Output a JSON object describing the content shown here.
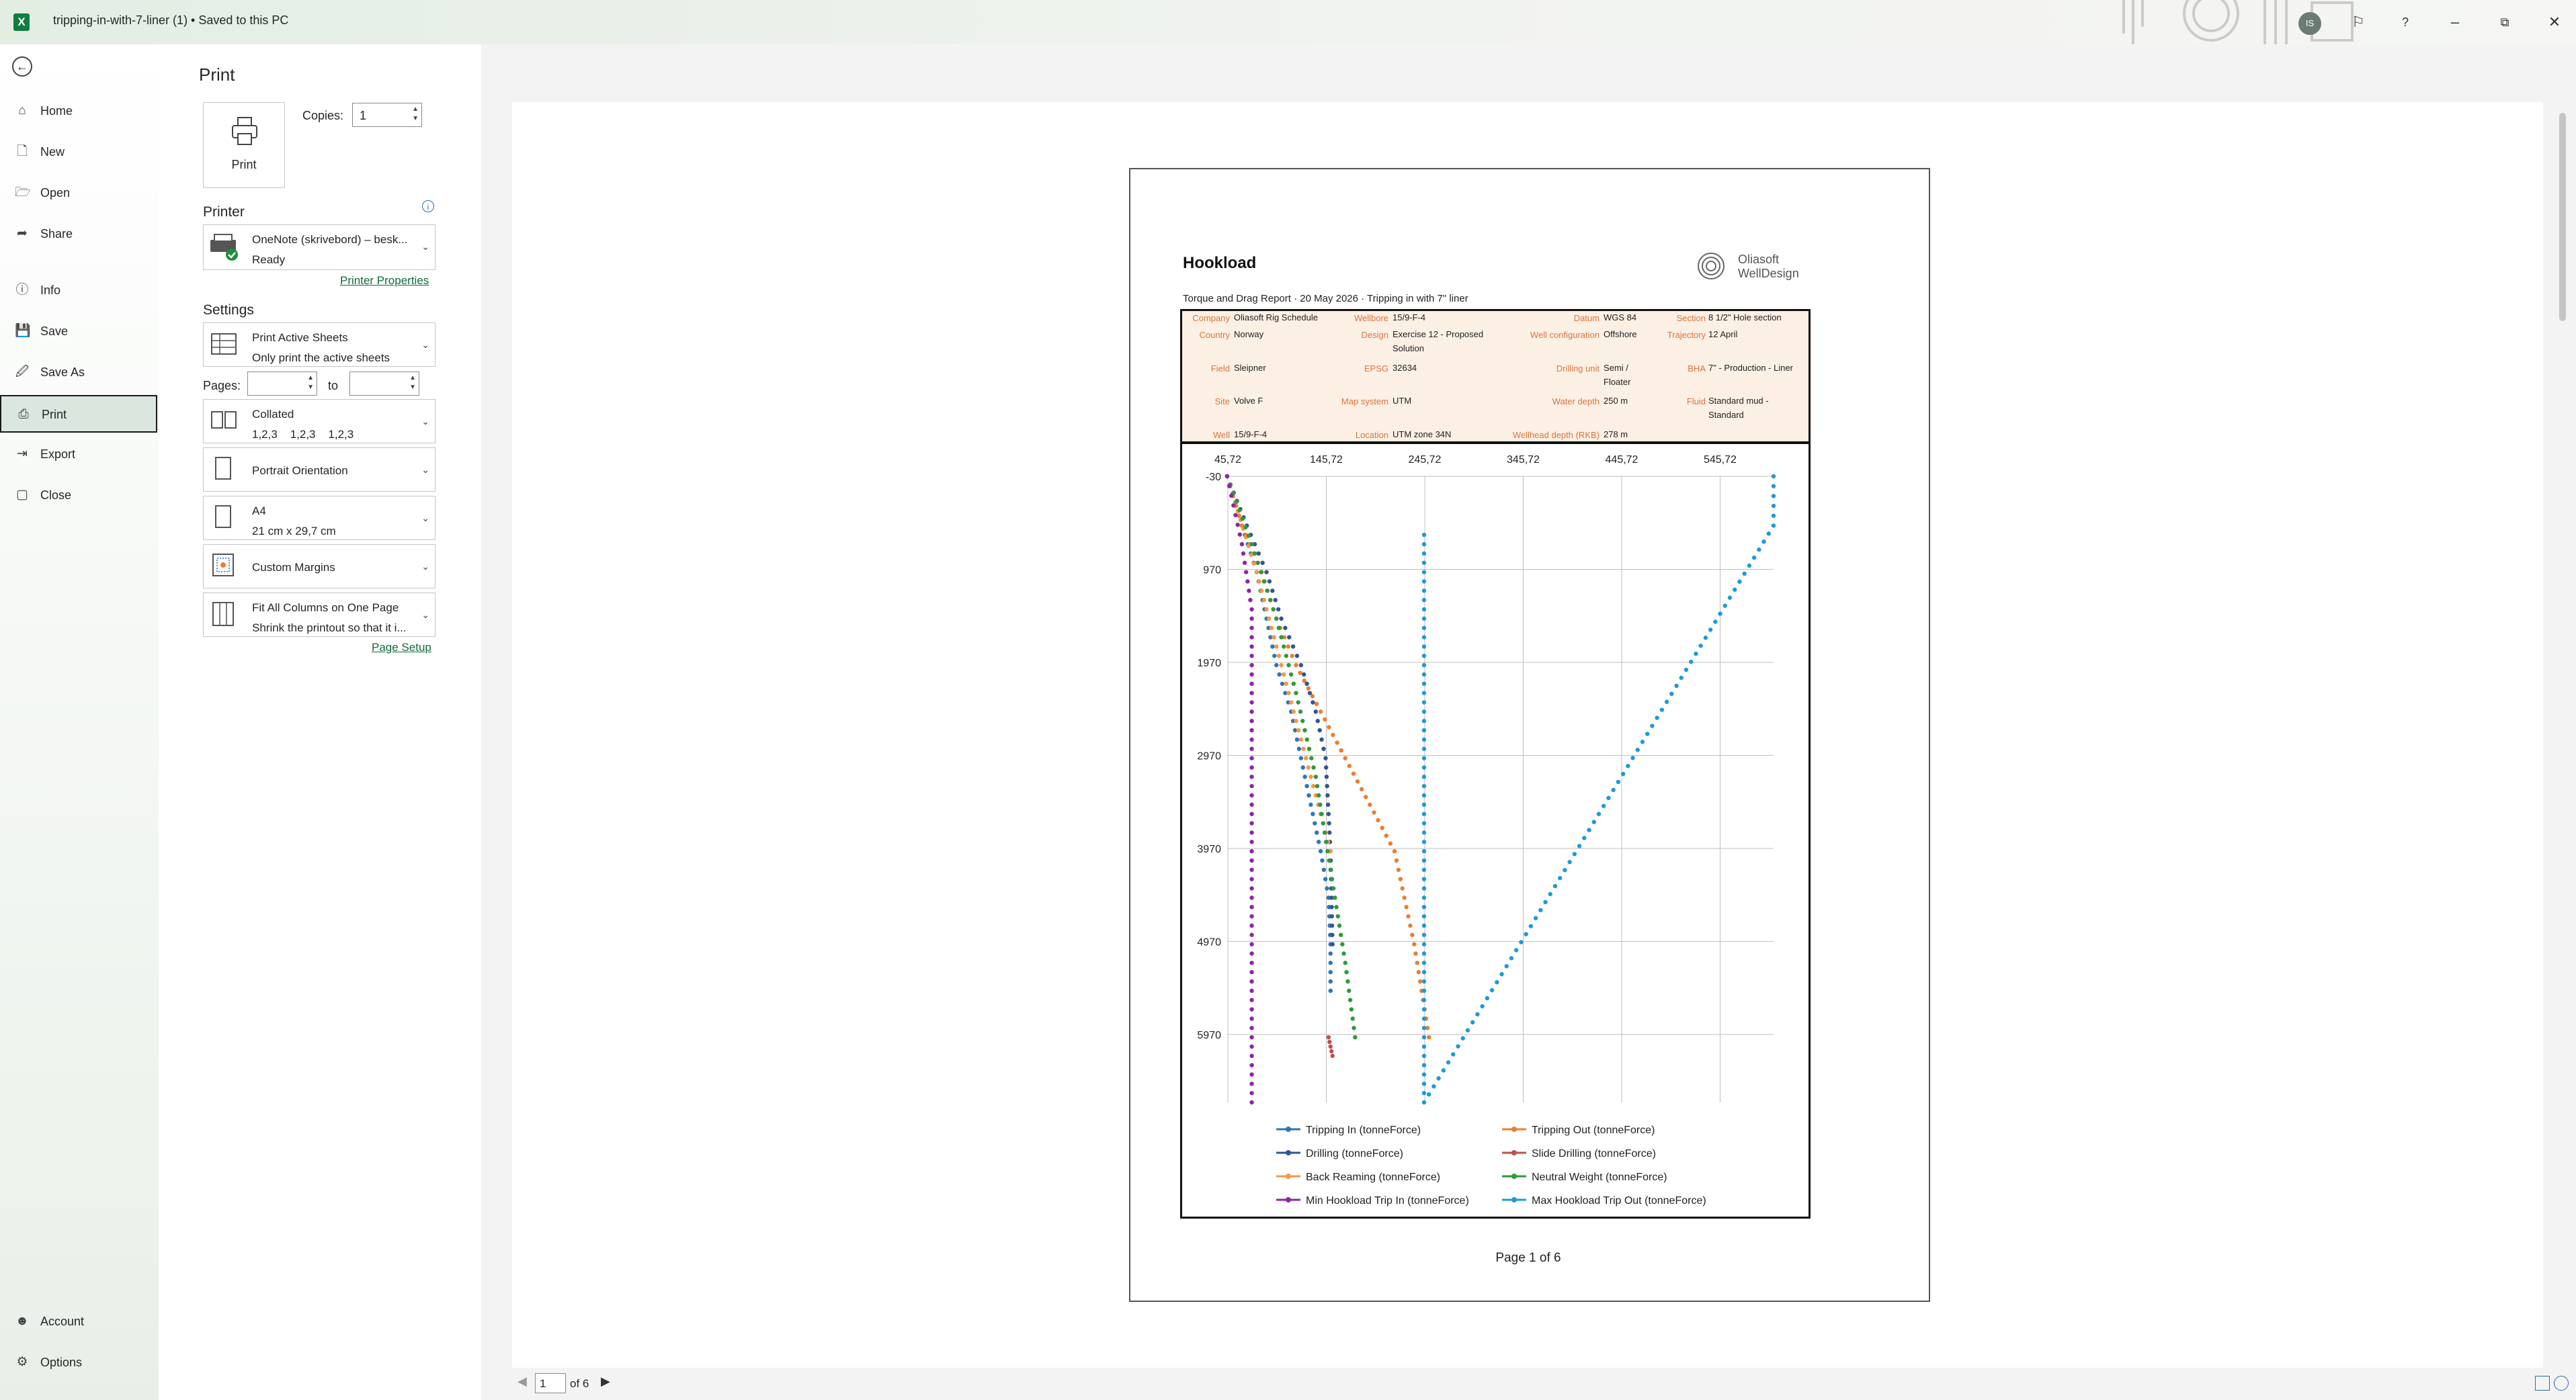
{
  "window": {
    "app_icon": "excel-icon",
    "doc_title": "tripping-in-with-7-liner (1) • Saved to this PC",
    "avatar_initials": "IS",
    "controls": [
      "feedback-icon",
      "help-icon",
      "minimize-icon",
      "restore-icon",
      "close-icon"
    ]
  },
  "nav": {
    "back_icon": "back-arrow-icon",
    "items": [
      {
        "label": "Home",
        "icon": "home-icon"
      },
      {
        "label": "New",
        "icon": "new-doc-icon"
      },
      {
        "label": "Open",
        "icon": "folder-icon"
      },
      {
        "label": "Share",
        "icon": "share-icon"
      },
      {
        "label": "Info",
        "icon": "info-icon"
      },
      {
        "label": "Save",
        "icon": "save-icon"
      },
      {
        "label": "Save As",
        "icon": "save-as-icon"
      },
      {
        "label": "Print",
        "icon": "printer-icon",
        "selected": true
      },
      {
        "label": "Export",
        "icon": "export-icon"
      },
      {
        "label": "Close",
        "icon": "close-doc-icon"
      }
    ],
    "bottom": [
      {
        "label": "Account",
        "icon": "person-icon"
      },
      {
        "label": "Options",
        "icon": "options-icon"
      }
    ]
  },
  "print": {
    "heading": "Print",
    "print_button": "Print",
    "copies_label": "Copies:",
    "copies_value": "1",
    "printer_heading": "Printer",
    "printer_name": "OneNote (skrivebord) – besk...",
    "printer_status": "Ready",
    "printer_properties": "Printer Properties",
    "settings_heading": "Settings",
    "settings": [
      {
        "l1": "Print Active Sheets",
        "l2": "Only print the active sheets",
        "icon": "sheets-icon"
      },
      {
        "l1": "Collated",
        "l2": "1,2,3    1,2,3    1,2,3",
        "icon": "collated-icon"
      },
      {
        "l1": "Portrait Orientation",
        "l2": "",
        "icon": "portrait-icon"
      },
      {
        "l1": "A4",
        "l2": "21 cm x 29,7 cm",
        "icon": "paper-size-icon"
      },
      {
        "l1": "Custom Margins",
        "l2": "",
        "icon": "margins-icon"
      },
      {
        "l1": "Fit All Columns on One Page",
        "l2": "Shrink the printout so that it i...",
        "icon": "fit-columns-icon"
      }
    ],
    "pages_label": "Pages:",
    "pages_from": "",
    "pages_to_label": "to",
    "pages_to": "",
    "page_setup": "Page Setup"
  },
  "report": {
    "title": "Hookload",
    "logo_line1": "Oliasoft",
    "logo_line2": "WellDesign",
    "subtitle": "Torque and Drag Report · 20 May 2026 · Tripping in with 7\" liner",
    "info": [
      {
        "k": "Company",
        "v": "Oliasoft Rig Schedule"
      },
      {
        "k": "Country",
        "v": "Norway"
      },
      {
        "k": "Field",
        "v": "Sleipner"
      },
      {
        "k": "Site",
        "v": "Volve F"
      },
      {
        "k": "Well",
        "v": "15/9-F-4"
      },
      {
        "k": "Wellbore",
        "v": "15/9-F-4"
      },
      {
        "k": "Design",
        "v": "Exercise 12 - Proposed Solution"
      },
      {
        "k": "EPSG",
        "v": "32634"
      },
      {
        "k": "Map system",
        "v": "UTM"
      },
      {
        "k": "Location",
        "v": "UTM zone 34N"
      },
      {
        "k": "Datum",
        "v": "WGS 84"
      },
      {
        "k": "Well configuration",
        "v": "Offshore"
      },
      {
        "k": "Drilling unit",
        "v": "Semi / Floater"
      },
      {
        "k": "Water depth",
        "v": "250 m"
      },
      {
        "k": "Wellhead depth (RKB)",
        "v": "278 m"
      },
      {
        "k": "Section",
        "v": "8 1/2\" Hole section"
      },
      {
        "k": "Trajectory",
        "v": "12 April"
      },
      {
        "k": "BHA",
        "v": "7\" - Production - Liner"
      },
      {
        "k": "Fluid",
        "v": "Standard mud - Standard"
      }
    ],
    "page_label": "Page 1 of 6"
  },
  "chart_data": {
    "type": "scatter",
    "title": "",
    "xlabel": "",
    "ylabel": "",
    "x_ticks": [
      "45,72",
      "145,72",
      "245,72",
      "345,72",
      "445,72",
      "545,72"
    ],
    "y_ticks": [
      "-30",
      "970",
      "1970",
      "2970",
      "3970",
      "4970",
      "5970"
    ],
    "xlim": [
      45.72,
      600
    ],
    "ylim": [
      6700,
      -30
    ],
    "legend_position": "bottom",
    "series": [
      {
        "name": "Tripping In (tonneForce)",
        "color": "#2e75b6",
        "x": [
          45,
          60,
          75,
          85,
          95,
          110,
          120,
          130,
          140,
          148,
          150,
          150
        ],
        "y": [
          -30,
          500,
          1000,
          1500,
          2000,
          2500,
          3000,
          3500,
          4000,
          4500,
          5000,
          5500
        ]
      },
      {
        "name": "Tripping Out (tonneForce)",
        "color": "#ed7d31",
        "x": [
          45,
          60,
          80,
          95,
          115,
          140,
          165,
          190,
          215,
          235,
          250
        ],
        "y": [
          -30,
          500,
          1000,
          1500,
          2000,
          2500,
          3000,
          3500,
          4000,
          5000,
          6000
        ]
      },
      {
        "name": "Drilling (tonneForce)",
        "color": "#2f5597",
        "x": [
          45,
          65,
          85,
          100,
          120,
          135,
          145,
          150,
          152
        ],
        "y": [
          -30,
          500,
          1000,
          1500,
          2000,
          2500,
          3000,
          4000,
          5000
        ]
      },
      {
        "name": "Slide Drilling (tonneForce)",
        "color": "#c0504d",
        "x": [
          148,
          150,
          152
        ],
        "y": [
          6000,
          6100,
          6200
        ]
      },
      {
        "name": "Back Reaming (tonneForce)",
        "color": "#f79646",
        "x": [
          45,
          75,
          100,
          125,
          150
        ],
        "y": [
          -30,
          1000,
          2000,
          3000,
          4000
        ]
      },
      {
        "name": "Neutral Weight (tonneForce)",
        "color": "#2e9a3a",
        "x": [
          45,
          70,
          95,
          115,
          135,
          150,
          165,
          175
        ],
        "y": [
          -30,
          700,
          1500,
          2300,
          3200,
          4200,
          5200,
          6000
        ]
      },
      {
        "name": "Min Hookload Trip In (tonneForce)",
        "color": "#8e24aa",
        "x": [
          45,
          60,
          70,
          70,
          70,
          70
        ],
        "y": [
          -30,
          700,
          1400,
          3000,
          5000,
          6700
        ]
      },
      {
        "name": "Max Hookload Trip Out (tonneForce)",
        "color": "#1e9ad6",
        "x": [
          245,
          245,
          245,
          245,
          600,
          600
        ],
        "y": [
          600,
          2000,
          4000,
          6700,
          500,
          -30
        ]
      }
    ]
  }
}
